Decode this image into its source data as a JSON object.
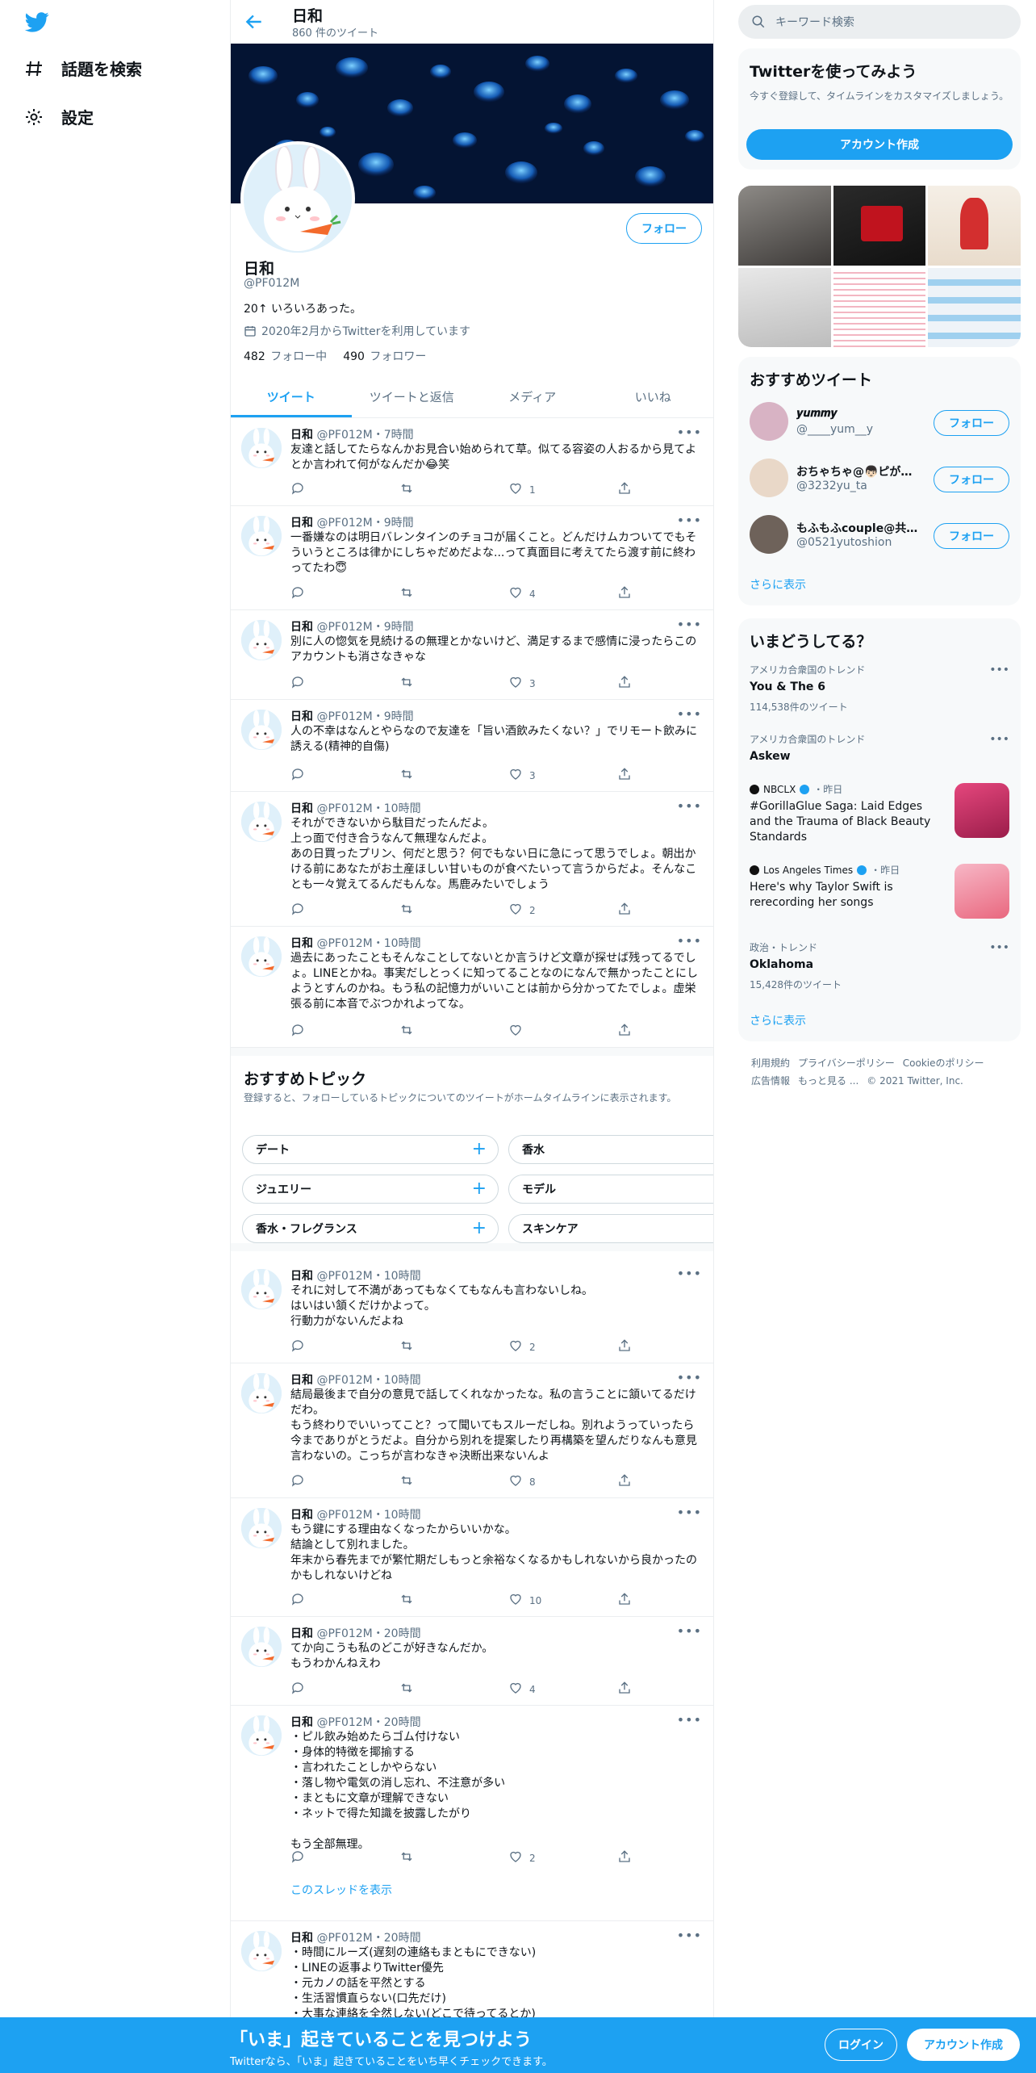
{
  "nav": {
    "explore": "話題を検索",
    "settings": "設定"
  },
  "header": {
    "title": "日和",
    "tweet_count": "860 件のツイート"
  },
  "profile": {
    "name": "日和",
    "handle": "@PF012M",
    "bio": "20↑ いろいろあった。",
    "joined": "2020年2月からTwitterを利用しています",
    "following_count": "482",
    "following_label": "フォロー中",
    "followers_count": "490",
    "followers_label": "フォロワー",
    "follow_button": "フォロー"
  },
  "tabs": [
    "ツイート",
    "ツイートと返信",
    "メディア",
    "いいね"
  ],
  "tweets": [
    {
      "name": "日和",
      "meta": "@PF012M・7時間",
      "text": "友達と話してたらなんかお見合い始められて草。似てる容姿の人おるから見てよとか言われて何がなんだか😂笑",
      "likes": "1"
    },
    {
      "name": "日和",
      "meta": "@PF012M・9時間",
      "text": "一番嫌なのは明日バレンタインのチョコが届くこと。どんだけムカついてでもそういうところは律かにしちゃだめだよな...って真面目に考えてたら渡す前に終わってたわ😇",
      "likes": "4"
    },
    {
      "name": "日和",
      "meta": "@PF012M・9時間",
      "text": "別に人の惚気を見続けるの無理とかないけど、満足するまで感情に浸ったらこのアカウントも消さなきゃな",
      "likes": "3"
    },
    {
      "name": "日和",
      "meta": "@PF012M・9時間",
      "text": "人の不幸はなんとやらなので友達を「旨い酒飲みたくない？」でリモート飲みに誘える(精神的自傷)",
      "likes": "3"
    },
    {
      "name": "日和",
      "meta": "@PF012M・10時間",
      "text": "それができないから駄目だったんだよ。\n上っ面で付き合うなんて無理なんだよ。\nあの日買ったプリン、何だと思う？何でもない日に急にって思うでしょ。朝出かける前にあなたがお土産ほしい甘いものが食べたいって言うからだよ。そんなことも一々覚えてるんだもんな。馬鹿みたいでしょう",
      "likes": "2"
    },
    {
      "name": "日和",
      "meta": "@PF012M・10時間",
      "text": "過去にあったこともそんなことしてないとか言うけど文章が探せば残ってるでしょ。LINEとかね。事実だしとっくに知ってることなのになんで無かったことにしようとすんのかね。もう私の記憶力がいいことは前から分かってたでしょ。虚栄張る前に本音でぶつかれよってな。",
      "likes": ""
    },
    {
      "name": "日和",
      "meta": "@PF012M・10時間",
      "text": "それに対して不満があってもなくてもなんも言わないしね。\nはいはい頷くだけかよって。\n行動力がないんだよね",
      "likes": "2"
    },
    {
      "name": "日和",
      "meta": "@PF012M・10時間",
      "text": "結局最後まで自分の意見で話してくれなかったな。私の言うことに頷いてるだけだわ。\nもう終わりでいいってこと？って聞いてもスルーだしね。別れようっていったら今までありがとうだよ。自分から別れを提案したり再構築を望んだりなんも意見言わないの。こっちが言わなきゃ決断出来ないんよ",
      "likes": "8"
    },
    {
      "name": "日和",
      "meta": "@PF012M・10時間",
      "text": "もう鍵にする理由なくなったからいいかな。\n結論として別れました。\n年末から春先までが繁忙期だしもっと余裕なくなるかもしれないから良かったのかもしれないけどね",
      "likes": "10"
    },
    {
      "name": "日和",
      "meta": "@PF012M・20時間",
      "text": "てか向こうも私のどこが好きなんだか。\nもうわかんねえわ",
      "likes": "4"
    },
    {
      "name": "日和",
      "meta": "@PF012M・20時間",
      "text": "・ピル飲み始めたらゴム付けない\n・身体的特徴を揶揄する\n・言われたことしかやらない\n・落し物や電気の消し忘れ、不注意が多い\n・まともに文章が理解できない\n・ネットで得た知識を披露したがり\n\nもう全部無理。",
      "likes": "2",
      "thread": "このスレッドを表示"
    },
    {
      "name": "日和",
      "meta": "@PF012M・20時間",
      "text": "・時間にルーズ(遅刻の連絡もまともにできない)\n・LINEの返事よりTwitter優先\n・元カノの話を平然とする\n・生活習慣直らない(口先だけ)\n・大事な連絡を全然しない(どこで待ってるとか)",
      "likes": ""
    }
  ],
  "topics": {
    "title": "おすすめトピック",
    "desc": "登録すると、フォローしているトピックについてのツイートがホームタイムラインに表示されます。",
    "items": [
      "デート",
      "香水",
      "ジュエリー",
      "モデル",
      "香水・フレグランス",
      "スキンケア"
    ]
  },
  "search": {
    "placeholder": "キーワード検索"
  },
  "signup": {
    "title": "Twitterを使ってみよう",
    "desc": "今すぐ登録して、タイムラインをカスタマイズしましょう。",
    "button": "アカウント作成"
  },
  "recommend": {
    "title": "おすすめツイート",
    "users": [
      {
        "name": "𝒚𝒖𝒎𝒎𝒚",
        "handle": "@____yum__y"
      },
      {
        "name": "おちゃちゃ@👦🏻ピが…",
        "handle": "@3232yu_ta"
      },
      {
        "name": "もふもふcouple@共…",
        "handle": "@0521yutoshion"
      }
    ],
    "follow": "フォロー",
    "more": "さらに表示"
  },
  "trends": {
    "title": "いまどうしてる？",
    "items": [
      {
        "context": "アメリカ合衆国のトレンド",
        "title": "You & The 6",
        "count": "114,538件のツイート"
      },
      {
        "context": "アメリカ合衆国のトレンド",
        "title": "Askew",
        "count": ""
      },
      {
        "context": "NBCLX",
        "time": "・昨日",
        "title": "#GorillaGlue Saga: Laid Edges and the Trauma of Black Beauty Standards"
      },
      {
        "context": "Los Angeles Times",
        "time": "・昨日",
        "title": "Here's why Taylor Swift is rerecording her songs"
      },
      {
        "context": "政治・トレンド",
        "title": "Oklahoma",
        "count": "15,428件のツイート"
      }
    ],
    "more": "さらに表示"
  },
  "footer": [
    "利用規約",
    "プライバシーポリシー",
    "Cookieのポリシー",
    "広告情報",
    "もっと見る ...",
    "© 2021 Twitter, Inc."
  ],
  "bottom": {
    "title": "「いま」起きていることを見つけよう",
    "desc": "Twitterなら、「いま」起きていることをいち早くチェックできます。",
    "login": "ログイン",
    "signup": "アカウント作成"
  },
  "colors": {
    "accent": "#1da1f2",
    "text": "#0f1419",
    "muted": "#5b7083"
  }
}
